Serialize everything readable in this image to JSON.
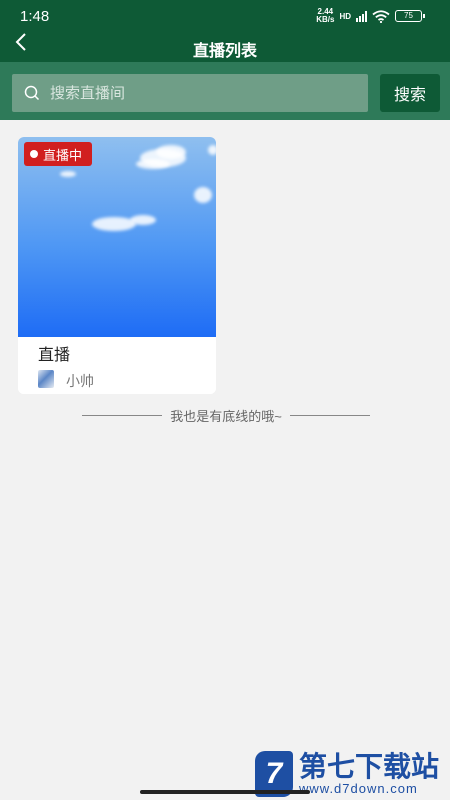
{
  "status_bar": {
    "time": "1:48",
    "network_speed": "2.44",
    "network_unit": "KB/s",
    "network_type": "HD",
    "battery": "75"
  },
  "nav": {
    "back_icon": "chevron-left-icon",
    "title": "直播列表"
  },
  "search": {
    "icon": "search-icon",
    "placeholder": "搜索直播间",
    "value": "",
    "button_label": "搜索"
  },
  "live_list": [
    {
      "badge": "直播中",
      "title": "直播",
      "author": "小帅"
    }
  ],
  "end_text": "我也是有底线的哦~",
  "watermark": {
    "logo": "7",
    "title": "第七下载站",
    "url": "www.d7down.com"
  },
  "colors": {
    "brand_green": "#0e5a36",
    "search_bar_green": "#2e7a59",
    "live_badge_red": "#d11f1f",
    "background": "#f2f2f2"
  }
}
